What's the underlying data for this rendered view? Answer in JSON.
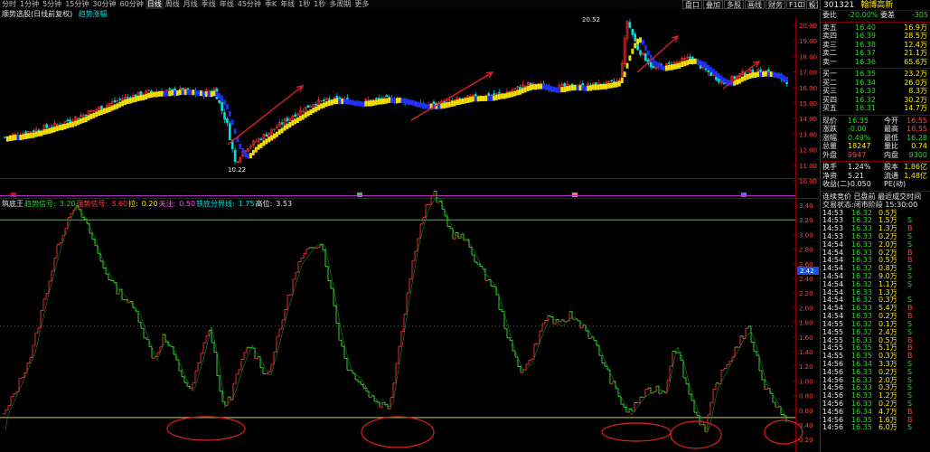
{
  "toolbar": {
    "periods": [
      "分时",
      "1分钟",
      "5分钟",
      "15分钟",
      "30分钟",
      "60分钟",
      "日线",
      "周线",
      "月线",
      "季线",
      "年线",
      "45分钟",
      "季K",
      "年线",
      "1秒",
      "1秒",
      "多周期",
      "更多"
    ],
    "right_buttons": [
      "盘口",
      "叠加",
      "多股",
      "画线",
      "财务",
      "F10",
      "设置"
    ],
    "close_label": "×",
    "restore_label": "□"
  },
  "main_legend": {
    "text1": "顺势选股(日线前复权)",
    "text2": "趋势涨幅"
  },
  "main_axis": {
    "labels": [
      "20.00",
      "19.00",
      "18.00",
      "17.00",
      "16.00",
      "15.00",
      "14.00",
      "13.00",
      "12.00",
      "11.00",
      "10.00"
    ],
    "high_marker": "20.52",
    "low_marker": "10.22"
  },
  "sub_legend": [
    {
      "label": "筑底王",
      "color": "#e6e6e6"
    },
    {
      "label": "趋势信号:",
      "color": "#2fd22f"
    },
    {
      "label": "3.20",
      "color": "#2fd22f"
    },
    {
      "label": "强势信号:",
      "color": "#ff4040"
    },
    {
      "label": "3.60",
      "color": "#ff4040"
    },
    {
      "label": "拉:",
      "color": "#ffea00"
    },
    {
      "label": "0.20",
      "color": "#ffea00"
    },
    {
      "label": "关注:",
      "color": "#ff50ff"
    },
    {
      "label": "0.50",
      "color": "#ff50ff"
    },
    {
      "label": "铁底分界线:",
      "color": "#00e0e0"
    },
    {
      "label": "1.75",
      "color": "#00e0e0"
    },
    {
      "label": "高位:",
      "color": "#e6e6e6"
    },
    {
      "label": "3.53",
      "color": "#e6e6e6"
    }
  ],
  "sub_axis": {
    "labels": [
      "3.40",
      "3.20",
      "3.00",
      "2.80",
      "2.60",
      "2.40",
      "2.20",
      "2.00",
      "1.80",
      "1.60",
      "1.40",
      "1.20",
      "1.00",
      "0.80",
      "0.60",
      "0.40",
      "0.20"
    ],
    "current_marker": "2.42"
  },
  "quote": {
    "code": "301321",
    "name": "翰博高新",
    "weibi_label": "委比",
    "weibi": "-20.00%",
    "weicha_label": "委差",
    "weicha": "-305",
    "sells": [
      {
        "label": "卖五",
        "price": "16.40",
        "vol": "16.9万"
      },
      {
        "label": "卖四",
        "price": "16.39",
        "vol": "28.5万"
      },
      {
        "label": "卖三",
        "price": "16.38",
        "vol": "12.4万"
      },
      {
        "label": "卖二",
        "price": "16.37",
        "vol": "21.1万"
      },
      {
        "label": "卖一",
        "price": "16.36",
        "vol": "65.6万"
      }
    ],
    "buys": [
      {
        "label": "买一",
        "price": "16.35",
        "vol": "23.2万"
      },
      {
        "label": "买二",
        "price": "16.34",
        "vol": "26.0万"
      },
      {
        "label": "买三",
        "price": "16.33",
        "vol": "8.3万"
      },
      {
        "label": "买四",
        "price": "16.32",
        "vol": "30.2万"
      },
      {
        "label": "买五",
        "price": "16.31",
        "vol": "14.7万"
      }
    ],
    "stats": [
      {
        "l1": "现价",
        "v1": "16.35",
        "c1": "c-green",
        "l2": "今开",
        "v2": "16.55",
        "c2": "c-red"
      },
      {
        "l1": "涨跌",
        "v1": "-0.00",
        "c1": "c-green",
        "l2": "最高",
        "v2": "16.55",
        "c2": "c-red"
      },
      {
        "l1": "涨幅",
        "v1": "0.49%",
        "c1": "c-green",
        "l2": "最低",
        "v2": "16.28",
        "c2": "c-green"
      },
      {
        "l1": "总量",
        "v1": "18247",
        "c1": "c-yel",
        "l2": "量比",
        "v2": "0.74",
        "c2": "c-yel"
      },
      {
        "l1": "外盘",
        "v1": "9947",
        "c1": "c-red",
        "l2": "内盘",
        "v2": "9300",
        "c2": "c-green"
      }
    ],
    "stats2": [
      {
        "l1": "换手",
        "v1": "1.24%",
        "l2": "股本",
        "v2": "1.86亿"
      },
      {
        "l1": "净资",
        "v1": "5.21",
        "l2": "流通",
        "v2": "1.48亿"
      },
      {
        "l1": "收益(二)",
        "v1": "-0.050",
        "l2": "PE(动)",
        "v2": ""
      }
    ],
    "status": [
      "连续竞价 已盘前 最近成交时间",
      "交易状态:闭市阶段 15:30:00"
    ],
    "ticks": [
      [
        "14:53",
        "16.32",
        "0.5万",
        ""
      ],
      [
        "14:53",
        "16.32",
        "1.5万",
        "S"
      ],
      [
        "14:53",
        "16.33",
        "1.3万",
        "B"
      ],
      [
        "14:53",
        "16.33",
        "0.2万",
        "S"
      ],
      [
        "14:54",
        "16.33",
        "2.0万",
        "S"
      ],
      [
        "14:54",
        "16.33",
        "0.2万",
        "B"
      ],
      [
        "14:54",
        "16.33",
        "0.5万",
        "B"
      ],
      [
        "14:54",
        "16.32",
        "0.8万",
        "S"
      ],
      [
        "14:54",
        "16.32",
        "9.0万",
        "S"
      ],
      [
        "14:54",
        "16.32",
        "1.1万",
        "S"
      ],
      [
        "14:54",
        "16.33",
        "1.3万",
        ""
      ],
      [
        "14:54",
        "16.32",
        "0.3万",
        "S"
      ],
      [
        "14:54",
        "16.33",
        "5.4万",
        "B"
      ],
      [
        "14:54",
        "16.33",
        "0.2万",
        "B"
      ],
      [
        "14:55",
        "16.32",
        "0.1万",
        "S"
      ],
      [
        "14:55",
        "16.32",
        "2.4万",
        "S"
      ],
      [
        "14:55",
        "16.33",
        "0.5万",
        "B"
      ],
      [
        "14:55",
        "16.35",
        "5.1万",
        "B"
      ],
      [
        "14:55",
        "16.35",
        "0.3万",
        "B"
      ],
      [
        "14:56",
        "16.34",
        "3.3万",
        "S"
      ],
      [
        "14:56",
        "16.33",
        "0.2万",
        "S"
      ],
      [
        "14:56",
        "16.33",
        "2.0万",
        "S"
      ],
      [
        "14:56",
        "16.33",
        "0.3万",
        "S"
      ],
      [
        "14:56",
        "16.33",
        "1.2万",
        "S"
      ],
      [
        "14:56",
        "16.33",
        "0.2万",
        "S"
      ],
      [
        "14:56",
        "16.34",
        "4.7万",
        "B"
      ],
      [
        "14:56",
        "16.35",
        "1.6万",
        "B"
      ],
      [
        "14:56",
        "16.35",
        "6.0万",
        "S"
      ]
    ]
  },
  "colors": {
    "up": "#ff3030",
    "down": "#00e0e0",
    "yellow": "#ffea00",
    "blue": "#2030ff",
    "green": "#2fd22f",
    "purple": "#b030c0",
    "ellipse": "#e02020"
  }
}
